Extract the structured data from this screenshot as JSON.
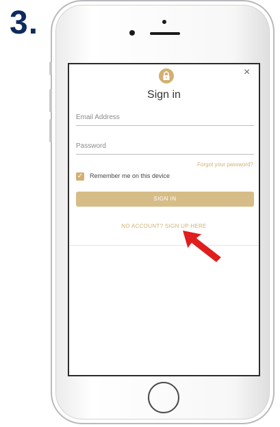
{
  "step": {
    "number": "3."
  },
  "modal": {
    "close": "×",
    "title": "Sign in",
    "email_label": "Email Address",
    "password_label": "Password",
    "forgot_password": "Forgot your password?",
    "remember_checked": true,
    "remember_label": "Remember me on this device",
    "signin_button": "SIGN IN",
    "signup_link": "NO ACCOUNT? SIGN UP HERE"
  },
  "colors": {
    "accent_gold": "#d2b072",
    "step_number": "#0d2b5c",
    "arrow": "#e01e1e"
  },
  "icons": [
    "lock-icon",
    "close-icon",
    "checkmark-icon",
    "pointer-arrow-icon"
  ]
}
